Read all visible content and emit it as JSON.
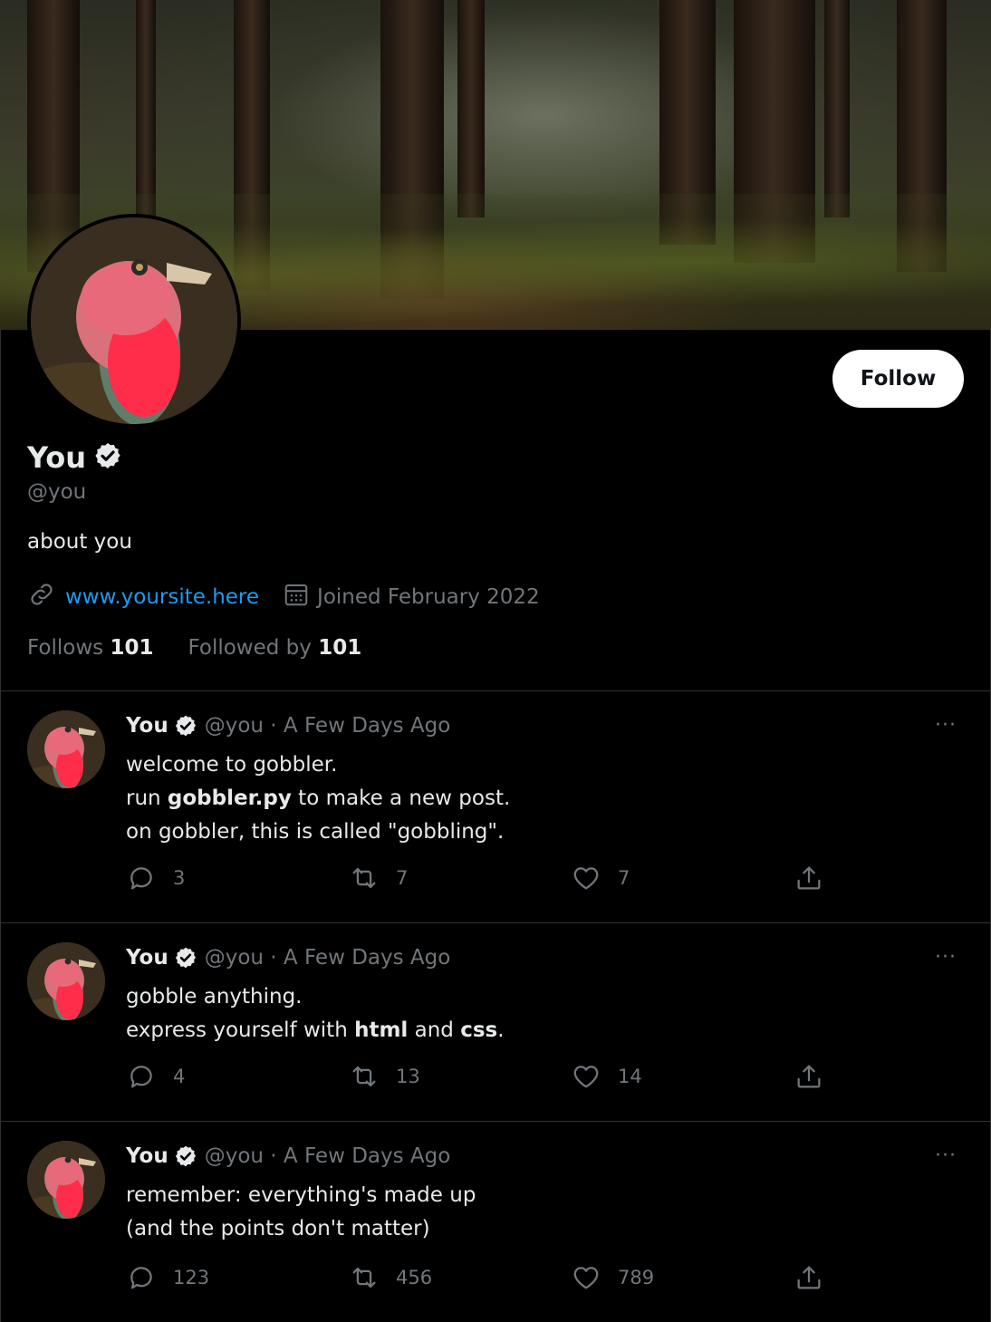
{
  "profile": {
    "name": "You",
    "handle": "@you",
    "bio": "about you",
    "website": "www.yoursite.here",
    "joined": "Joined February 2022",
    "follows_label": "Follows",
    "follows_count": "101",
    "followed_by_label": "Followed by",
    "followed_by_count": "101",
    "follow_button": "Follow"
  },
  "posts": [
    {
      "name": "You",
      "meta": "@you · A Few Days Ago",
      "more": "···",
      "lines": [
        [
          "welcome to gobbler."
        ],
        [
          "run ",
          "gobbler.py",
          " to make a new post."
        ],
        [
          "on gobbler, this is called \"gobbling\"."
        ]
      ],
      "replies": "3",
      "reposts": "7",
      "likes": "7"
    },
    {
      "name": "You",
      "meta": "@you · A Few Days Ago",
      "more": "···",
      "lines": [
        [
          "gobble anything."
        ],
        [
          "express yourself with ",
          "html",
          " and ",
          "css",
          "."
        ]
      ],
      "replies": "4",
      "reposts": "13",
      "likes": "14"
    },
    {
      "name": "You",
      "meta": "@you · A Few Days Ago",
      "more": "···",
      "lines": [
        [
          "remember: everything's made up"
        ],
        [
          "(and the points don't matter)"
        ]
      ],
      "replies": "123",
      "reposts": "456",
      "likes": "789"
    }
  ],
  "colors": {
    "background": "#000000",
    "text": "#e7e9ea",
    "muted": "#71767b",
    "link": "#1d9bf0",
    "divider": "#2f3336"
  },
  "icons": {
    "verified": "verified-badge-icon",
    "link": "link-icon",
    "calendar": "calendar-icon",
    "reply": "reply-icon",
    "repost": "repost-icon",
    "like": "heart-icon",
    "share": "share-icon"
  }
}
